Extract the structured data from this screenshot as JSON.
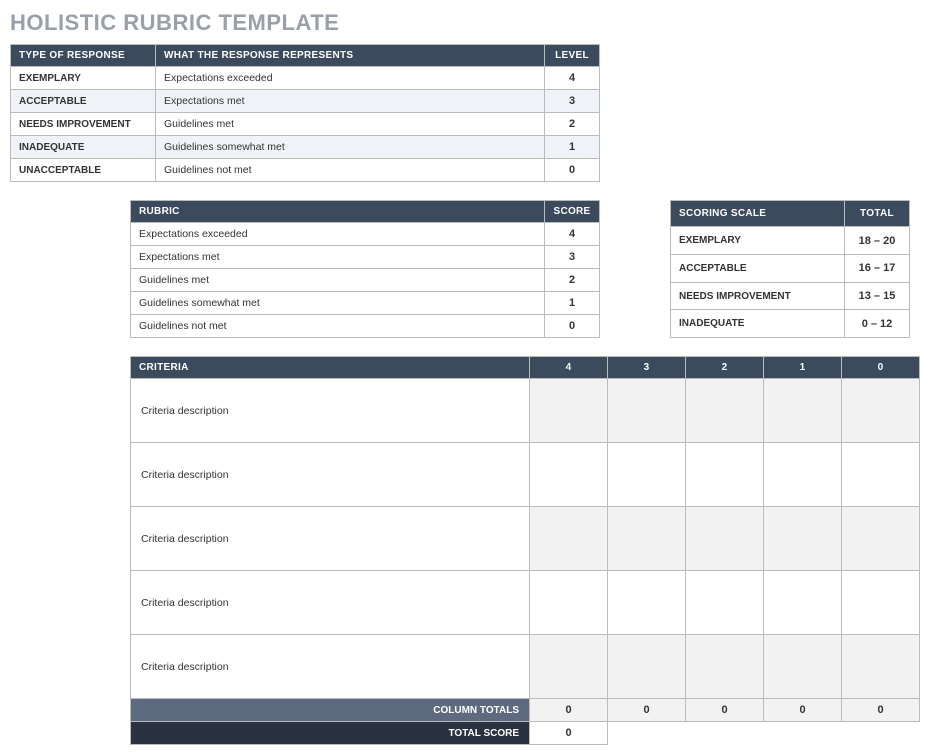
{
  "title": "HOLISTIC RUBRIC TEMPLATE",
  "type_table": {
    "headers": {
      "c1": "TYPE OF RESPONSE",
      "c2": "WHAT THE RESPONSE REPRESENTS",
      "c3": "LEVEL"
    },
    "rows": [
      {
        "type": "EXEMPLARY",
        "desc": "Expectations exceeded",
        "level": "4"
      },
      {
        "type": "ACCEPTABLE",
        "desc": "Expectations met",
        "level": "3"
      },
      {
        "type": "NEEDS IMPROVEMENT",
        "desc": "Guidelines met",
        "level": "2"
      },
      {
        "type": "INADEQUATE",
        "desc": "Guidelines somewhat met",
        "level": "1"
      },
      {
        "type": "UNACCEPTABLE",
        "desc": "Guidelines not met",
        "level": "0"
      }
    ]
  },
  "rubric_table": {
    "headers": {
      "c1": "RUBRIC",
      "c2": "SCORE"
    },
    "rows": [
      {
        "desc": "Expectations exceeded",
        "score": "4"
      },
      {
        "desc": "Expectations met",
        "score": "3"
      },
      {
        "desc": "Guidelines met",
        "score": "2"
      },
      {
        "desc": "Guidelines somewhat met",
        "score": "1"
      },
      {
        "desc": "Guidelines not met",
        "score": "0"
      }
    ]
  },
  "scale_table": {
    "headers": {
      "c1": "SCORING SCALE",
      "c2": "TOTAL"
    },
    "rows": [
      {
        "label": "EXEMPLARY",
        "range": "18 – 20"
      },
      {
        "label": "ACCEPTABLE",
        "range": "16 – 17"
      },
      {
        "label": "NEEDS IMPROVEMENT",
        "range": "13 – 15"
      },
      {
        "label": "INADEQUATE",
        "range": "0 – 12"
      }
    ]
  },
  "criteria_table": {
    "headers": {
      "c1": "CRITERIA",
      "s4": "4",
      "s3": "3",
      "s2": "2",
      "s1": "1",
      "s0": "0"
    },
    "rows": [
      {
        "desc": "Criteria description"
      },
      {
        "desc": "Criteria description"
      },
      {
        "desc": "Criteria description"
      },
      {
        "desc": "Criteria description"
      },
      {
        "desc": "Criteria description"
      }
    ],
    "column_totals_label": "COLUMN TOTALS",
    "column_totals": [
      "0",
      "0",
      "0",
      "0",
      "0"
    ],
    "total_score_label": "TOTAL SCORE",
    "total_score": "0"
  }
}
